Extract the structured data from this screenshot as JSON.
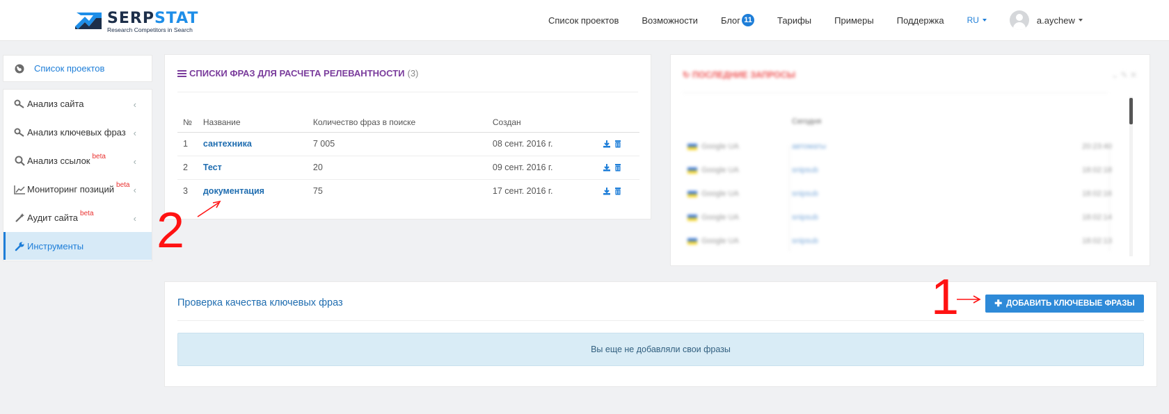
{
  "header": {
    "logo_name_a": "SERP",
    "logo_name_b": "STAT",
    "logo_sub": "Research Competitors in Search",
    "nav": [
      "Список проектов",
      "Возможности",
      "Блог",
      "Тарифы",
      "Примеры",
      "Поддержка"
    ],
    "blog_badge": "11",
    "lang": "RU",
    "user": "a.aychew"
  },
  "sidebar": {
    "top_item": "Список проектов",
    "items": [
      {
        "label": "Анализ сайта",
        "beta": ""
      },
      {
        "label": "Анализ ключевых фраз",
        "beta": ""
      },
      {
        "label": "Анализ ссылок",
        "beta": "beta"
      },
      {
        "label": "Мониторинг позиций",
        "beta": "beta"
      },
      {
        "label": "Аудит сайта",
        "beta": "beta"
      },
      {
        "label": "Инструменты",
        "beta": ""
      }
    ]
  },
  "phrase_lists": {
    "title": "СПИСКИ ФРАЗ ДЛЯ РАСЧЕТА РЕЛЕВАНТНОСТИ",
    "count": "(3)",
    "columns": [
      "№",
      "Название",
      "Количество фраз в поиске",
      "Создан"
    ],
    "rows": [
      {
        "n": "1",
        "name": "сантехника",
        "qty": "7 005",
        "created": "08 сент. 2016 г."
      },
      {
        "n": "2",
        "name": "Тест",
        "qty": "20",
        "created": "09 сент. 2016 г."
      },
      {
        "n": "3",
        "name": "документация",
        "qty": "75",
        "created": "17 сент. 2016 г."
      }
    ]
  },
  "recent": {
    "title": "ПОСЛЕДНИЕ ЗАПРОСЫ",
    "col_today": "Сегодня",
    "rows": [
      {
        "engine": "Google UA",
        "kw": "автоматы",
        "time": "20:23:40"
      },
      {
        "engine": "Google UA",
        "kw": "snipsub",
        "time": "18:02:18"
      },
      {
        "engine": "Google UA",
        "kw": "snipsub",
        "time": "18:02:16"
      },
      {
        "engine": "Google UA",
        "kw": "snipsub",
        "time": "18:02:14"
      },
      {
        "engine": "Google UA",
        "kw": "snipsub",
        "time": "18:02:13"
      }
    ]
  },
  "quality": {
    "title": "Проверка качества ключевых фраз",
    "button": "ДОБАВИТЬ КЛЮЧЕВЫЕ ФРАЗЫ",
    "empty": "Вы еще не добавляли свои фразы"
  },
  "annotations": {
    "one": "1",
    "two": "2"
  },
  "colors": {
    "accent": "#1e7ed8",
    "title_purple": "#7a3c9c",
    "annotation_red": "#ff1212",
    "active_bg": "#d7eaf7"
  }
}
